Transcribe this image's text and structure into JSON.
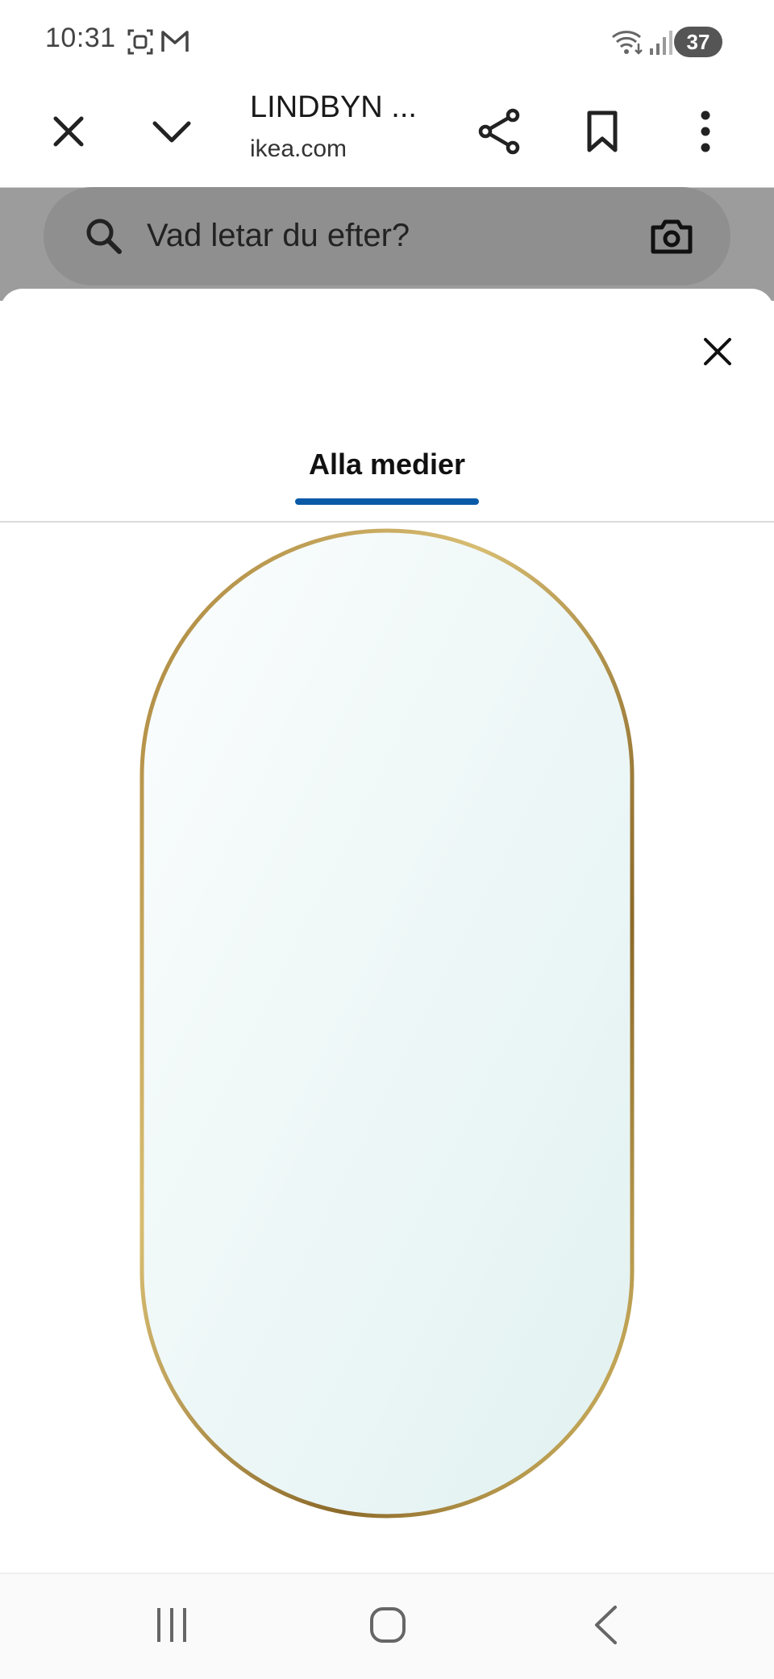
{
  "status_bar": {
    "time": "10:31",
    "battery": "37",
    "icons": [
      "screenshot-icon",
      "gmail-icon",
      "wifi-icon",
      "signal-icon"
    ]
  },
  "browser": {
    "page_title": "LINDBYN ...",
    "url": "ikea.com",
    "icons": [
      "close-icon",
      "chevron-down-icon",
      "share-icon",
      "bookmark-icon",
      "more-vert-icon"
    ]
  },
  "search": {
    "placeholder": "Vad letar du efter?"
  },
  "modal": {
    "tab_label": "Alla medier",
    "image_alt": "LINDBYN mirror, gold-colour oval frame",
    "colors": {
      "tab_underline": "#0a5aa8",
      "frame_gold": "#c9a64e",
      "glass": "#eaf4f4"
    }
  },
  "nav_bar": {
    "icons": [
      "recents-icon",
      "home-icon",
      "back-icon"
    ]
  }
}
